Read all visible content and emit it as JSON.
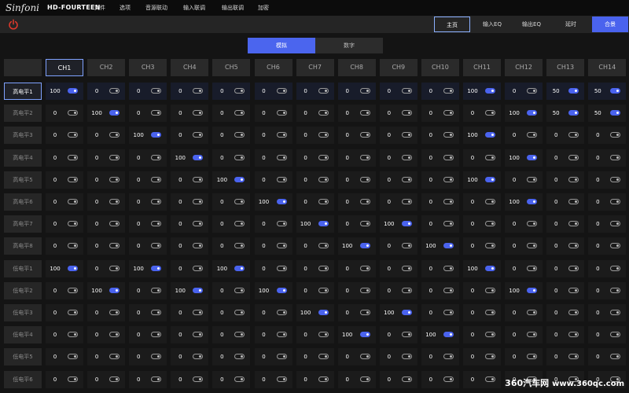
{
  "app": {
    "logo": "Sinfoni",
    "model": "HD-FOURTEEN"
  },
  "menu": [
    "文件",
    "选项",
    "音源联动",
    "输入联调",
    "输出联调",
    "加密"
  ],
  "nav": [
    "主页",
    "输入EQ",
    "输出EQ",
    "延时",
    "合景"
  ],
  "modes": [
    "模拟",
    "数字"
  ],
  "channels": [
    "CH1",
    "CH2",
    "CH3",
    "CH4",
    "CH5",
    "CH6",
    "CH7",
    "CH8",
    "CH9",
    "CH10",
    "CH11",
    "CH12",
    "CH13",
    "CH14"
  ],
  "rows": [
    {
      "label": "高电平1",
      "values": [
        100,
        0,
        0,
        0,
        0,
        0,
        0,
        0,
        0,
        0,
        100,
        0,
        50,
        50
      ]
    },
    {
      "label": "高电平2",
      "values": [
        0,
        100,
        0,
        0,
        0,
        0,
        0,
        0,
        0,
        0,
        0,
        100,
        50,
        50
      ]
    },
    {
      "label": "高电平3",
      "values": [
        0,
        0,
        100,
        0,
        0,
        0,
        0,
        0,
        0,
        0,
        100,
        0,
        0,
        0
      ]
    },
    {
      "label": "高电平4",
      "values": [
        0,
        0,
        0,
        100,
        0,
        0,
        0,
        0,
        0,
        0,
        0,
        100,
        0,
        0
      ]
    },
    {
      "label": "高电平5",
      "values": [
        0,
        0,
        0,
        0,
        100,
        0,
        0,
        0,
        0,
        0,
        100,
        0,
        0,
        0
      ]
    },
    {
      "label": "高电平6",
      "values": [
        0,
        0,
        0,
        0,
        0,
        100,
        0,
        0,
        0,
        0,
        0,
        100,
        0,
        0
      ]
    },
    {
      "label": "高电平7",
      "values": [
        0,
        0,
        0,
        0,
        0,
        0,
        100,
        0,
        100,
        0,
        0,
        0,
        0,
        0
      ]
    },
    {
      "label": "高电平8",
      "values": [
        0,
        0,
        0,
        0,
        0,
        0,
        0,
        100,
        0,
        100,
        0,
        0,
        0,
        0
      ]
    },
    {
      "label": "低电平1",
      "values": [
        100,
        0,
        100,
        0,
        100,
        0,
        0,
        0,
        0,
        0,
        100,
        0,
        0,
        0
      ]
    },
    {
      "label": "低电平2",
      "values": [
        0,
        100,
        0,
        100,
        0,
        100,
        0,
        0,
        0,
        0,
        0,
        100,
        0,
        0
      ]
    },
    {
      "label": "低电平3",
      "values": [
        0,
        0,
        0,
        0,
        0,
        0,
        100,
        0,
        100,
        0,
        0,
        0,
        0,
        0
      ]
    },
    {
      "label": "低电平4",
      "values": [
        0,
        0,
        0,
        0,
        0,
        0,
        0,
        100,
        0,
        100,
        0,
        0,
        0,
        0
      ]
    },
    {
      "label": "低电平5",
      "values": [
        0,
        0,
        0,
        0,
        0,
        0,
        0,
        0,
        0,
        0,
        0,
        0,
        0,
        0
      ]
    },
    {
      "label": "低电平6",
      "values": [
        0,
        0,
        0,
        0,
        0,
        0,
        0,
        0,
        0,
        0,
        0,
        0,
        0,
        0
      ]
    }
  ],
  "selected": {
    "channel": "CH1",
    "row": "高电平1",
    "nav": "主页",
    "mode": "模拟"
  },
  "colors": {
    "accent": "#4a63ee",
    "selected_outline": "#7fa2ff",
    "toggle_on": "#4a63ee"
  },
  "watermark": {
    "brand": "360汽车网",
    "url": "www.360qc.com"
  }
}
